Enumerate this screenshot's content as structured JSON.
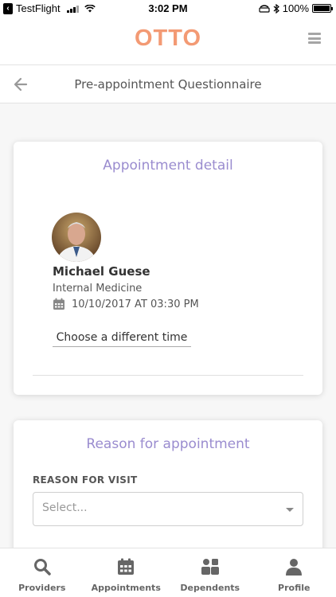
{
  "status_bar": {
    "back_app": "TestFlight",
    "time": "3:02 PM",
    "battery": "100%",
    "battery_level": 1.0
  },
  "header": {
    "logo": "OTTO",
    "accent_color": "#f39a74"
  },
  "sub_header": {
    "title": "Pre-appointment Questionnaire"
  },
  "appointment_card": {
    "title": "Appointment detail",
    "doctor_name": "Michael Guese",
    "specialty": "Internal Medicine",
    "datetime": "10/10/2017 AT 03:30 PM",
    "change_time_label": "Choose a different time"
  },
  "reason_card": {
    "title": "Reason for appointment",
    "field_label": "REASON FOR VISIT",
    "select_placeholder": "Select..."
  },
  "tab_bar": {
    "tabs": [
      {
        "label": "Providers",
        "icon": "search-icon"
      },
      {
        "label": "Appointments",
        "icon": "calendar-icon"
      },
      {
        "label": "Dependents",
        "icon": "dependents-icon"
      },
      {
        "label": "Profile",
        "icon": "profile-icon"
      }
    ]
  }
}
